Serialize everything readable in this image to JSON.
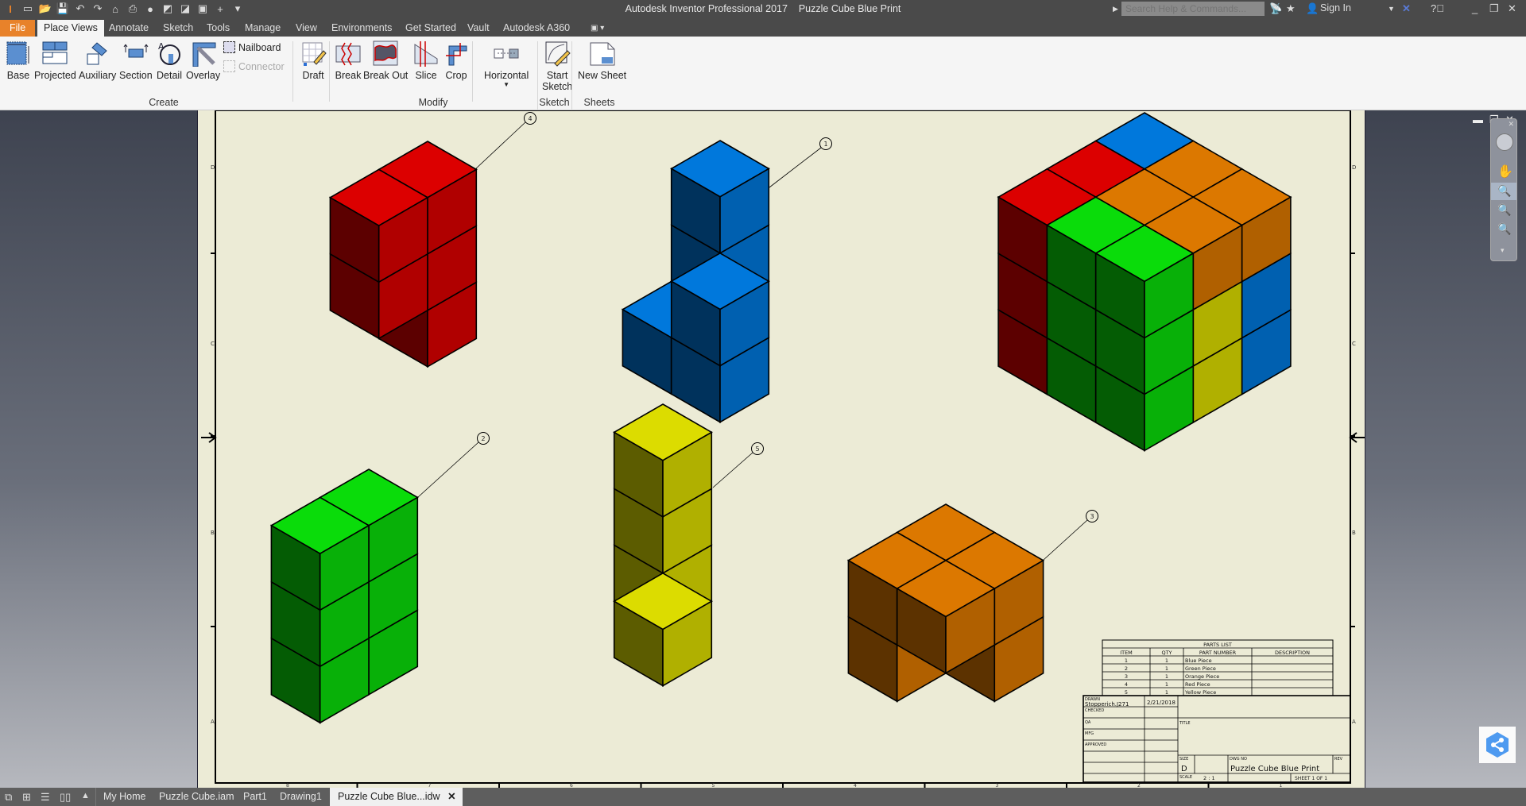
{
  "titlebar": {
    "app_name": "Autodesk Inventor Professional 2017",
    "document": "Puzzle Cube Blue Print",
    "search_placeholder": "Search Help & Commands...",
    "sign_in": "Sign In"
  },
  "menu": {
    "file": "File",
    "tabs": [
      "Place Views",
      "Annotate",
      "Sketch",
      "Tools",
      "Manage",
      "View",
      "Environments",
      "Get Started",
      "Vault",
      "Autodesk A360"
    ],
    "active_tab": "Place Views"
  },
  "ribbon": {
    "create": {
      "label": "Create",
      "buttons": [
        "Base",
        "Projected",
        "Auxiliary",
        "Section",
        "Detail",
        "Overlay"
      ],
      "small": [
        "Nailboard",
        "Connector"
      ]
    },
    "draft": "Draft",
    "modify": {
      "label": "Modify",
      "buttons": [
        "Break",
        "Break Out",
        "Slice",
        "Crop"
      ]
    },
    "horizontal": "Horizontal",
    "sketch": {
      "label": "Sketch",
      "button_line1": "Start",
      "button_line2": "Sketch"
    },
    "sheets": {
      "label": "Sheets",
      "button": "New Sheet"
    }
  },
  "drawing": {
    "zone_rows": [
      "D",
      "C",
      "B",
      "A"
    ],
    "zone_cols": [
      "8",
      "7",
      "6",
      "5",
      "4",
      "3",
      "2",
      "1"
    ],
    "balloons": [
      "1",
      "2",
      "3",
      "4",
      "5"
    ],
    "colors": {
      "red": "#dc0000",
      "blue": "#0078dc",
      "green": "#0adc0a",
      "yellow": "#dcdc00",
      "orange": "#dc7800"
    },
    "parts_list": {
      "title": "PARTS LIST",
      "headers": [
        "ITEM",
        "QTY",
        "PART NUMBER",
        "DESCRIPTION"
      ],
      "rows": [
        [
          "1",
          "1",
          "Blue Piece",
          ""
        ],
        [
          "2",
          "1",
          "Green Piece",
          ""
        ],
        [
          "3",
          "1",
          "Orange Piece",
          ""
        ],
        [
          "4",
          "1",
          "Red Piece",
          ""
        ],
        [
          "5",
          "1",
          "Yellow Piece",
          ""
        ]
      ]
    },
    "title_block": {
      "drawn_label": "DRAWN",
      "drawn_by": "Stopperich.J271",
      "drawn_date": "2/21/2018",
      "checked_label": "CHECKED",
      "qa_label": "QA",
      "mfg_label": "MFG",
      "approved_label": "APPROVED",
      "title_label": "TITLE",
      "size_label": "SIZE",
      "size": "D",
      "dwg_no_label": "DWG NO",
      "dwg_no": "Puzzle Cube Blue Print",
      "rev_label": "REV",
      "scale_label": "SCALE",
      "scale": "2 : 1",
      "sheet": "SHEET 1  OF 1"
    }
  },
  "statusbar": {
    "tabs": [
      "My Home",
      "Puzzle Cube.iam",
      "Part1",
      "Drawing1",
      "Puzzle Cube Blue...idw"
    ],
    "active": "Puzzle Cube Blue...idw"
  }
}
